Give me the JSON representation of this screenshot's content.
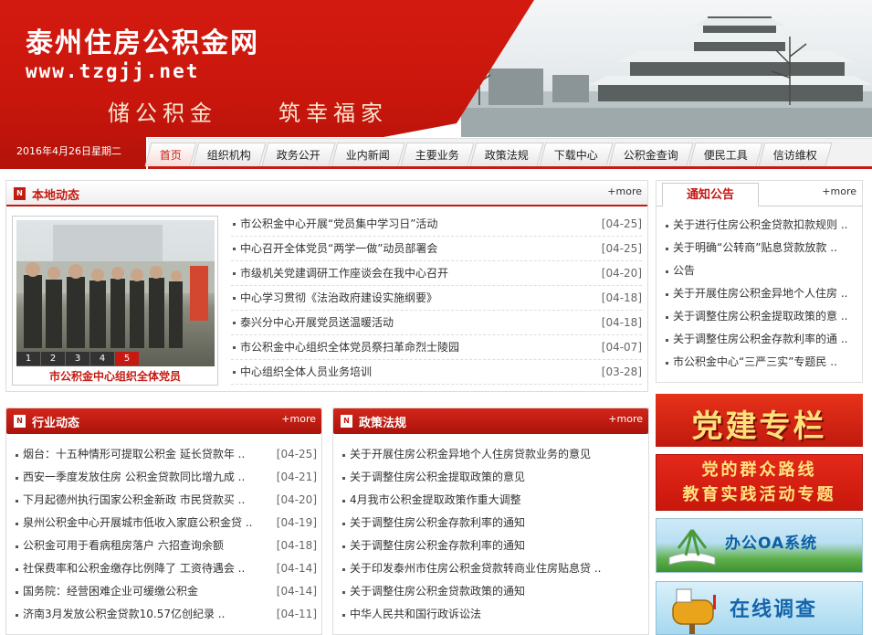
{
  "header": {
    "site_title": "泰州住房公积金网",
    "site_url": "www.tzgjj.net",
    "slogan_1": "储公积金",
    "slogan_2": "筑幸福家",
    "date": "2016年4月26日星期二"
  },
  "nav": {
    "items": [
      "首页",
      "组织机构",
      "政务公开",
      "业内新闻",
      "主要业务",
      "政策法规",
      "下载中心",
      "公积金查询",
      "便民工具",
      "信访维权"
    ],
    "active": "首页"
  },
  "local_news": {
    "title": "本地动态",
    "more": "+more",
    "photo_caption": "市公积金中心组织全体党员",
    "photo_pages": [
      "1",
      "2",
      "3",
      "4",
      "5"
    ],
    "photo_active": "5",
    "items": [
      {
        "title": "市公积金中心开展“党员集中学习日”活动",
        "date": "[04-25]"
      },
      {
        "title": "中心召开全体党员“两学一做”动员部署会",
        "date": "[04-25]"
      },
      {
        "title": "市级机关党建调研工作座谈会在我中心召开",
        "date": "[04-20]"
      },
      {
        "title": "中心学习贯彻《法治政府建设实施纲要》",
        "date": "[04-18]"
      },
      {
        "title": "泰兴分中心开展党员送温暖活动",
        "date": "[04-18]"
      },
      {
        "title": "市公积金中心组织全体党员祭扫革命烈士陵园",
        "date": "[04-07]"
      },
      {
        "title": "中心组织全体人员业务培训",
        "date": "[03-28]"
      }
    ]
  },
  "notice": {
    "title": "通知公告",
    "more": "+more",
    "items": [
      "关于进行住房公积金贷款扣款规则 ..",
      "关于明确“公转商”贴息贷款放款 ..",
      "公告",
      "关于开展住房公积金异地个人住房 ..",
      "关于调整住房公积金提取政策的意 ..",
      "关于调整住房公积金存款利率的通 ..",
      "市公积金中心“三严三实”专题民 .."
    ]
  },
  "industry": {
    "title": "行业动态",
    "more": "+more",
    "items": [
      {
        "title": "烟台：十五种情形可提取公积金  延长贷款年 ..",
        "date": "[04-25]"
      },
      {
        "title": "西安一季度发放住房  公积金贷款同比增九成 ..",
        "date": "[04-21]"
      },
      {
        "title": "下月起德州执行国家公积金新政  市民贷款买 ..",
        "date": "[04-20]"
      },
      {
        "title": "泉州公积金中心开展城市低收入家庭公积金贷 ..",
        "date": "[04-19]"
      },
      {
        "title": "公积金可用于看病租房落户  六招查询余额",
        "date": "[04-18]"
      },
      {
        "title": "社保费率和公积金缴存比例降了  工资待遇会 ..",
        "date": "[04-14]"
      },
      {
        "title": "国务院：经营困难企业可缓缴公积金",
        "date": "[04-14]"
      },
      {
        "title": "济南3月发放公积金贷款10.57亿创纪录 ..",
        "date": "[04-11]"
      }
    ]
  },
  "policy": {
    "title": "政策法规",
    "more": "+more",
    "items": [
      "关于开展住房公积金异地个人住房贷款业务的意见",
      "关于调整住房公积金提取政策的意见",
      "4月我市公积金提取政策作重大调整",
      "关于调整住房公积金存款利率的通知",
      "关于调整住房公积金存款利率的通知",
      "关于印发泰州市住房公积金贷款转商业住房贴息贷 ..",
      "关于调整住房公积金贷款政策的通知",
      "中华人民共和国行政诉讼法"
    ]
  },
  "banners": {
    "party": "党建专栏",
    "mass_line_1": "党的群众路线",
    "mass_line_2": "教育实践活动专题",
    "oa": "办公OA系统",
    "survey": "在线调查"
  },
  "colors": {
    "brand_red": "#c51a12",
    "accent_gold": "#ffe07a"
  }
}
